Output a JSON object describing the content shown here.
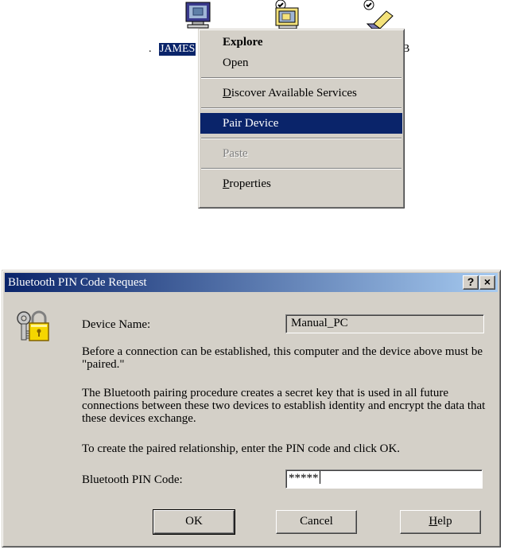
{
  "desktop": {
    "selected_label": "JAMES",
    "right_label": "B",
    "dot_label": "."
  },
  "context_menu": {
    "items": [
      {
        "label": "Explore"
      },
      {
        "label": "Open"
      },
      {
        "label_pre": "",
        "label_ul": "D",
        "label_post": "iscover Available Services"
      },
      {
        "label": "Pair Device"
      },
      {
        "label": "Paste"
      },
      {
        "label_pre": "",
        "label_ul": "P",
        "label_post": "roperties"
      }
    ]
  },
  "dialog": {
    "title": "Bluetooth PIN Code Request",
    "help_glyph": "?",
    "close_glyph": "×",
    "device_name_label": "Device Name:",
    "device_name_value": "Manual_PC",
    "paragraph1": "Before a connection can be established, this computer and the device above must be \"paired.\"",
    "paragraph2": "The Bluetooth pairing procedure creates a secret key that is used in all future connections between these two devices to establish identity and encrypt the data that these devices exchange.",
    "paragraph3": "To create the paired relationship, enter the PIN code and click OK.",
    "pin_label": "Bluetooth PIN Code:",
    "pin_value": "*****",
    "ok_label": "OK",
    "cancel_label": "Cancel",
    "help_label_ul": "H",
    "help_label_post": "elp"
  }
}
